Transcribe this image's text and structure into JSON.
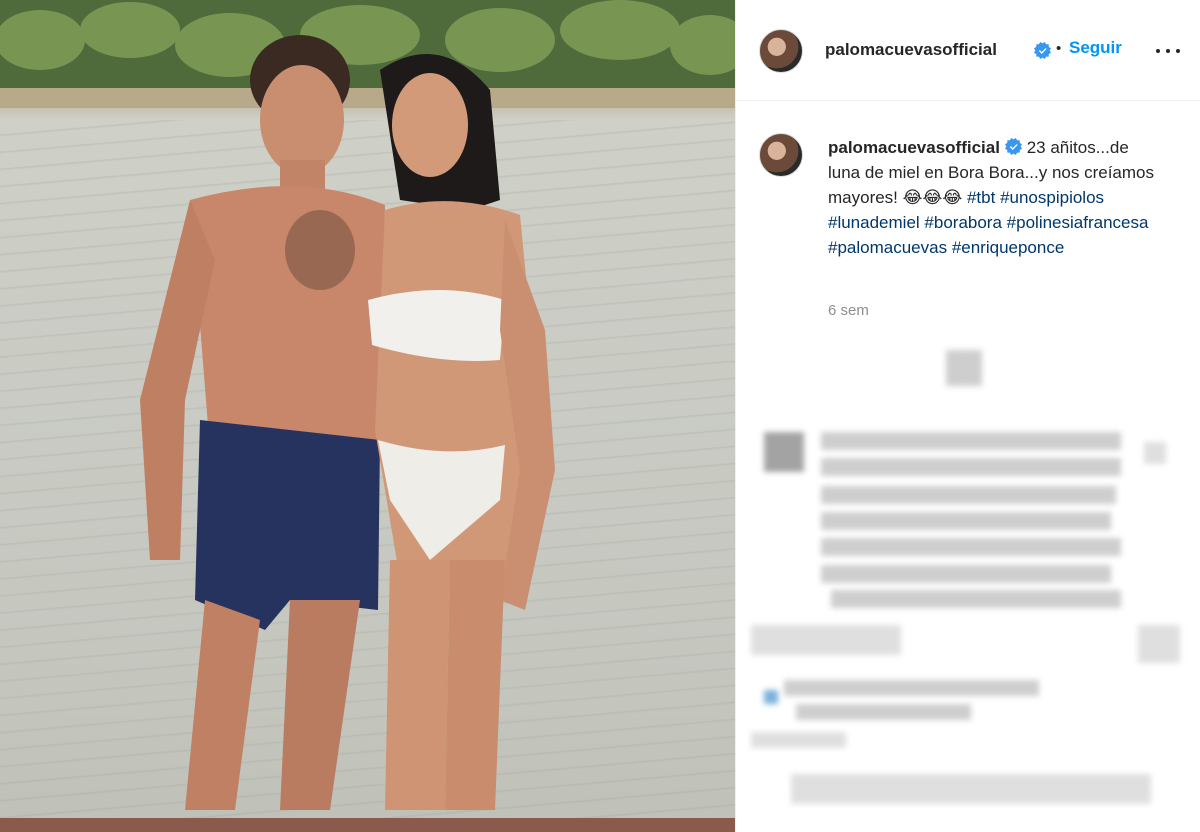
{
  "post": {
    "username": "palomacuevasofficial",
    "follow_label": "Seguir",
    "separator": "•",
    "caption_text": "23 añitos...de luna de miel en Bora Bora...y nos creíamos mayores! 😂😂😂",
    "hashtags": [
      "#tbt",
      "#unospipiolos",
      "#lunademiel",
      "#borabora",
      "#polinesiafrancesa",
      "#palomacuevas",
      "#enriqueponce"
    ],
    "time_ago": "6 sem"
  },
  "colors": {
    "accent": "#0095f6",
    "hashtag": "#00376b",
    "verified": "#3897f0",
    "muted": "#8e8e8e"
  },
  "icons": {
    "verified": "verified-badge-icon",
    "more": "more-options-icon"
  }
}
